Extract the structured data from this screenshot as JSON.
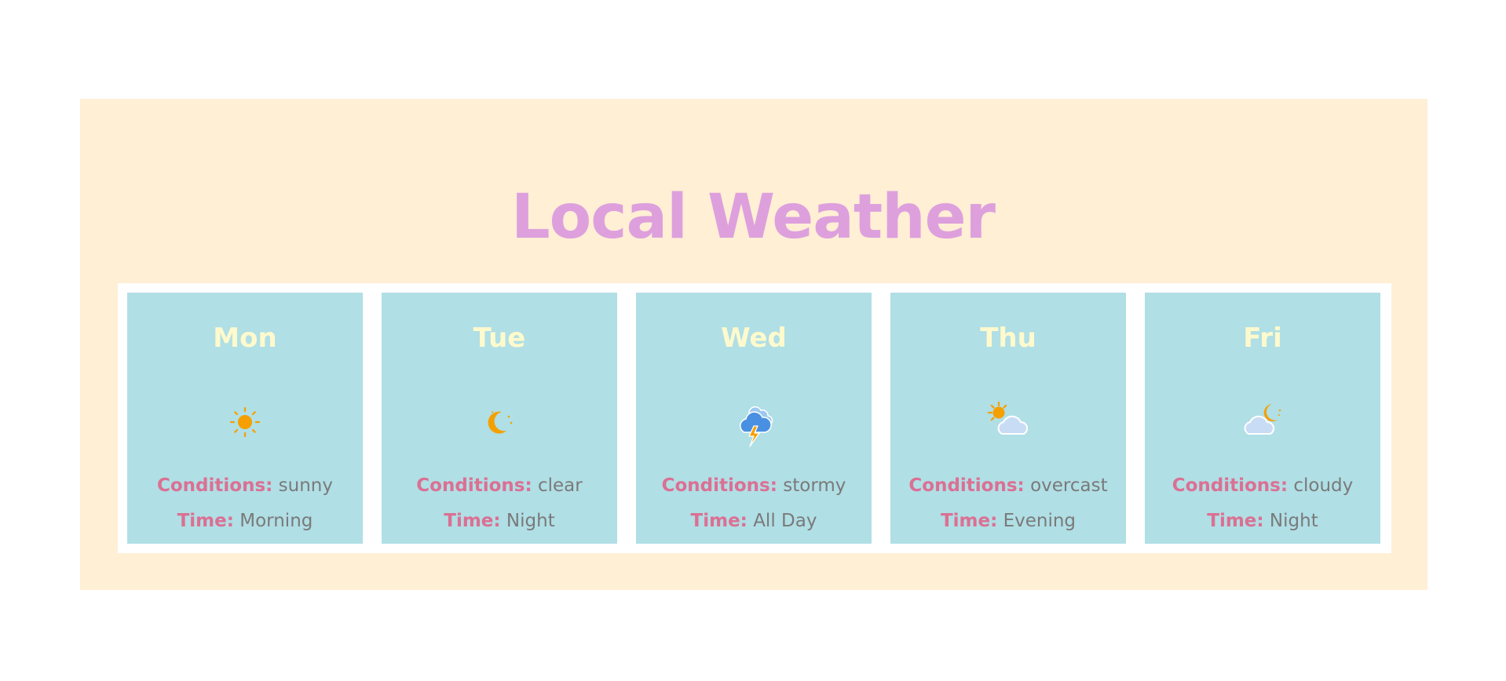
{
  "page": {
    "title": "Local Weather",
    "conditions_label": "Conditions:",
    "time_label": "Time:"
  },
  "colors": {
    "panel_bg": "#FFEFD5",
    "title": "#DDA0DD",
    "card_bg": "#B0DFE5",
    "day": "#FFFACD",
    "label": "#DB7093",
    "value": "#7a7a7a"
  },
  "forecast": [
    {
      "day": "Mon",
      "icon": "sun-icon",
      "conditions": "sunny",
      "time": "Morning"
    },
    {
      "day": "Tue",
      "icon": "moon-icon",
      "conditions": "clear",
      "time": "Night"
    },
    {
      "day": "Wed",
      "icon": "thunderstorm-icon",
      "conditions": "stormy",
      "time": "All Day"
    },
    {
      "day": "Thu",
      "icon": "sun-behind-cloud-icon",
      "conditions": "overcast",
      "time": "Evening"
    },
    {
      "day": "Fri",
      "icon": "moon-behind-cloud-icon",
      "conditions": "cloudy",
      "time": "Night"
    }
  ]
}
